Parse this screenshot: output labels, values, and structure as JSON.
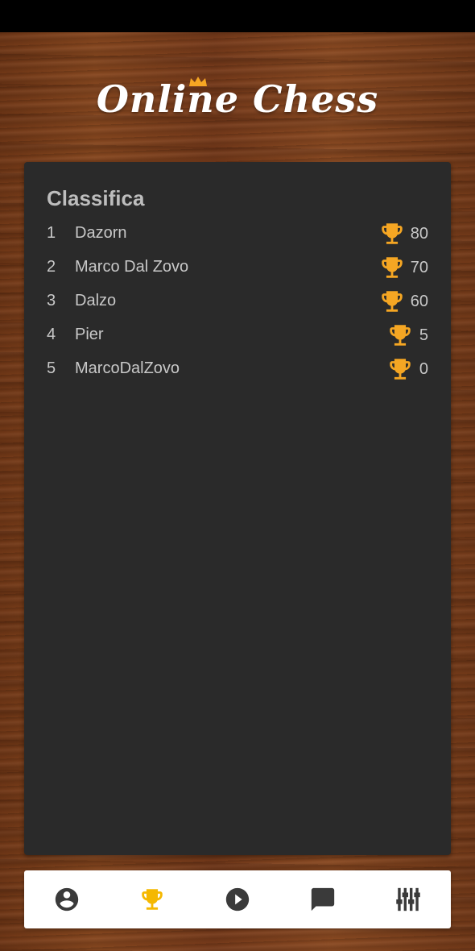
{
  "app": {
    "title": "Online Chess"
  },
  "leaderboard": {
    "title": "Classifica",
    "rows": [
      {
        "rank": "1",
        "name": "Dazorn",
        "score": "80"
      },
      {
        "rank": "2",
        "name": "Marco Dal Zovo",
        "score": "70"
      },
      {
        "rank": "3",
        "name": "Dalzo",
        "score": "60"
      },
      {
        "rank": "4",
        "name": "Pier",
        "score": "5"
      },
      {
        "rank": "5",
        "name": "MarcoDalZovo",
        "score": "0"
      }
    ]
  },
  "nav": {
    "items": [
      {
        "id": "profile",
        "icon": "account-circle-icon",
        "active": false
      },
      {
        "id": "leaderboard",
        "icon": "trophy-icon",
        "active": true
      },
      {
        "id": "play",
        "icon": "play-circle-icon",
        "active": false
      },
      {
        "id": "chat",
        "icon": "chat-icon",
        "active": false
      },
      {
        "id": "settings",
        "icon": "equalizer-icon",
        "active": false
      }
    ]
  },
  "colors": {
    "trophy": "#f5a623",
    "nav_active": "#f5b800",
    "nav_inactive": "#3a3a3a",
    "card_bg": "#2a2a2a",
    "text": "#c8c8c8"
  }
}
